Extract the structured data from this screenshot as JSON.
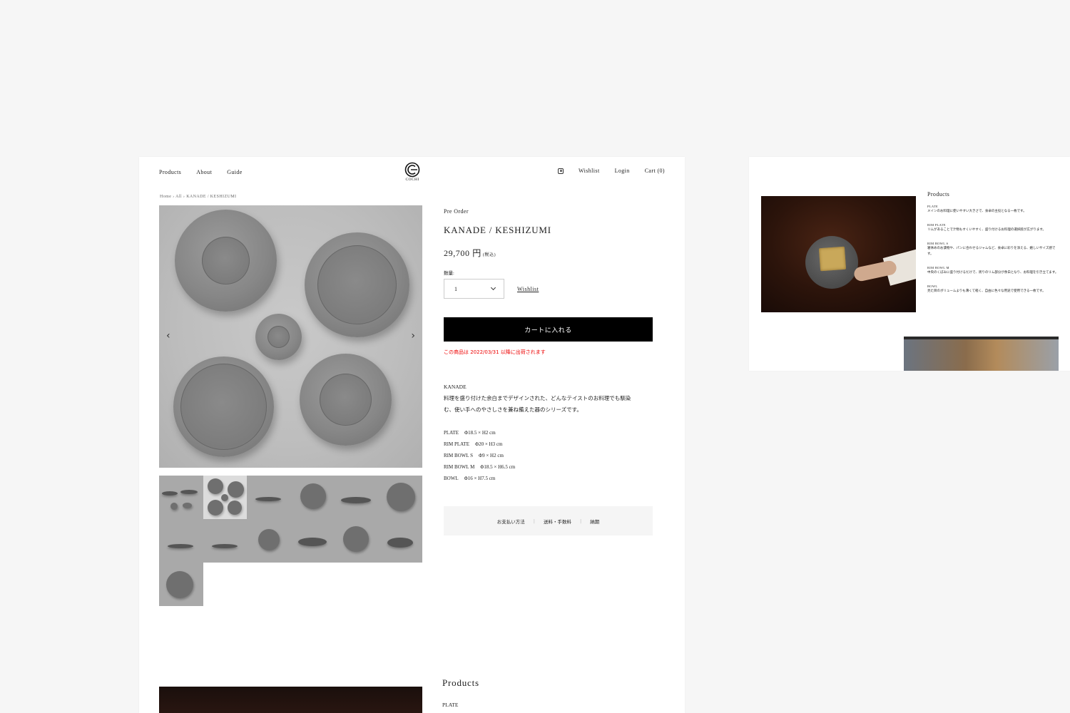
{
  "nav": {
    "left": [
      "Products",
      "About",
      "Guide"
    ],
    "logo_text": "COCHI",
    "wishlist": "Wishlist",
    "login": "Login",
    "cart": "Cart (0)"
  },
  "breadcrumb": "Home › All › KANADE / KESHIZUMI",
  "product": {
    "preorder": "Pre Order",
    "title": "KANADE / KESHIZUMI",
    "price": "29,700 円",
    "tax_note": "(税込)",
    "qty_label": "数量:",
    "qty_value": "1",
    "wishlist_link": "Wishlist",
    "cart_button": "カートに入れる",
    "ship_note": "この商品は 2022/03/31 以降に出荷されます",
    "desc_en": "KANADE",
    "desc_lines": [
      "料理を盛り付けた余白までデザインされた、どんなテイストのお料理でも馴染",
      "む、使い手へのやさしさを兼ね備えた器のシリーズです。"
    ],
    "specs": [
      {
        "name": "PLATE",
        "size": "Φ18.5 × H2 cm"
      },
      {
        "name": "RIM PLATE",
        "size": "Φ20 × H3 cm"
      },
      {
        "name": "RIM BOWL S",
        "size": "Φ9 × H2 cm"
      },
      {
        "name": "RIM BOWL M",
        "size": "Φ18.5 × H6.5 cm"
      },
      {
        "name": "BOWL",
        "size": "Φ16 × H7.5 cm"
      }
    ],
    "info_tabs": [
      "お支払い方法",
      "送料・手数料",
      "納期"
    ]
  },
  "lower": {
    "title": "Products",
    "first_item": "PLATE"
  },
  "side": {
    "title": "Products",
    "items": [
      {
        "name": "PLATE",
        "text": "メインのお料理に使いやすい大きさで、食卓の主役となる一枚です。"
      },
      {
        "name": "RIM PLATE",
        "text": "リムがあることで汁物もすくいやすく、盛り付けるお料理の選択肢が広がります。"
      },
      {
        "name": "RIM BOWL S",
        "text": "箸休めのお漬物や、パンに合わせるジャムなど、食卓に彩りを添える、嬉しいサイズ感です。"
      },
      {
        "name": "RIM BOWL M",
        "text": "中央のくぼみに盛り付けるだけで、周りのリム部分が余白となり、お料理を引き立てます。"
      },
      {
        "name": "BOWL",
        "text": "見た目のボリュームよりも薄くて軽く、自由に色々な用途で使用できる一枚です。"
      }
    ]
  },
  "icons": {
    "instagram": "instagram-icon",
    "prev": "chevron-left-icon",
    "next": "chevron-right-icon",
    "dropdown": "chevron-down-icon"
  }
}
